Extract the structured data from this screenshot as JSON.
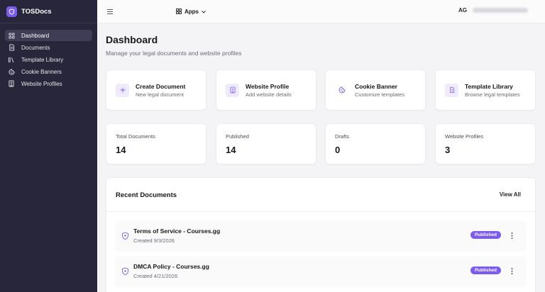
{
  "brand": {
    "name": "TOSDocs"
  },
  "sidebar": {
    "items": [
      {
        "label": "Dashboard",
        "icon": "grid-icon",
        "active": true
      },
      {
        "label": "Documents",
        "icon": "file-icon"
      },
      {
        "label": "Template Library",
        "icon": "library-icon"
      },
      {
        "label": "Cookie Banners",
        "icon": "cookie-icon"
      },
      {
        "label": "Website Profiles",
        "icon": "building-icon"
      }
    ]
  },
  "topbar": {
    "apps_label": "Apps",
    "user_initials": "AG"
  },
  "page": {
    "title": "Dashboard",
    "subtitle": "Manage your legal documents and website profiles"
  },
  "quick_actions": [
    {
      "title": "Create Document",
      "desc": "New legal document",
      "icon": "plus-icon"
    },
    {
      "title": "Website Profile",
      "desc": "Add website details",
      "icon": "building-icon"
    },
    {
      "title": "Cookie Banner",
      "desc": "Customize templates",
      "icon": "cookie-icon"
    },
    {
      "title": "Template Library",
      "desc": "Browse legal templates",
      "icon": "file-text-icon"
    }
  ],
  "stats": [
    {
      "label": "Total Documents",
      "value": "14"
    },
    {
      "label": "Published",
      "value": "14"
    },
    {
      "label": "Drafts",
      "value": "0"
    },
    {
      "label": "Website Profiles",
      "value": "3"
    }
  ],
  "recent": {
    "title": "Recent Documents",
    "view_all": "View All",
    "rows": [
      {
        "name": "Terms of Service - Courses.gg",
        "created": "Created 9/3/2026",
        "status": "Published"
      },
      {
        "name": "DMCA Policy - Courses.gg",
        "created": "Created 4/21/2026",
        "status": "Published"
      }
    ]
  },
  "colors": {
    "accent": "#7c5cf0",
    "sidebar_bg": "#27263a",
    "page_bg": "#f4f4f6"
  }
}
